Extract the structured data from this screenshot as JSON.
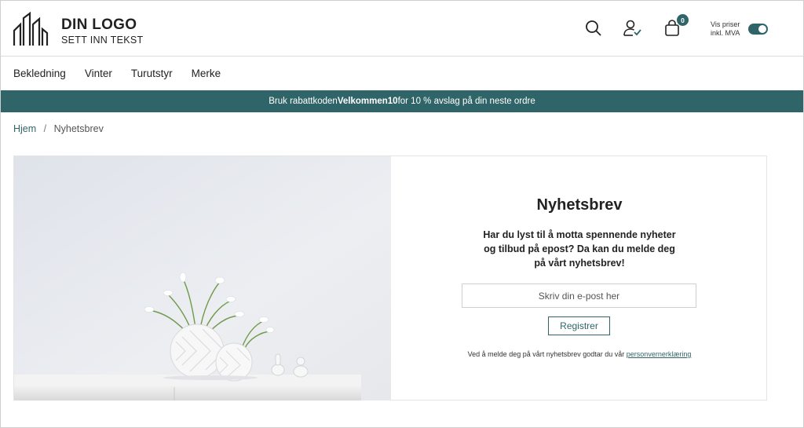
{
  "header": {
    "logo_title": "DIN LOGO",
    "logo_subtitle": "SETT INN TEKST",
    "cart_count": "0",
    "vat_label": "Vis priser inkl. MVA"
  },
  "nav": {
    "items": [
      "Bekledning",
      "Vinter",
      "Turutstyr",
      "Merke"
    ]
  },
  "promo": {
    "before": "Bruk rabattkoden ",
    "code": "Velkommen10",
    "after": " for 10 % avslag på din neste ordre"
  },
  "breadcrumb": {
    "home": "Hjem",
    "separator": "/",
    "current": "Nyhetsbrev"
  },
  "newsletter": {
    "title": "Nyhetsbrev",
    "description": "Har du lyst til å motta spennende nyheter og tilbud på epost? Da kan du melde deg på vårt nyhetsbrev!",
    "email_placeholder": "Skriv din e-post her",
    "register_label": "Registrer",
    "consent_text": "Ved å melde deg på vårt nyhetsbrev godtar du vår ",
    "consent_link": "personvernerklæring"
  },
  "colors": {
    "accent": "#2f6568",
    "border": "#dcdcdc"
  },
  "icons": [
    "buildings-logo-icon",
    "search-icon",
    "user-check-icon",
    "shopping-bag-icon",
    "toggle-switch"
  ]
}
